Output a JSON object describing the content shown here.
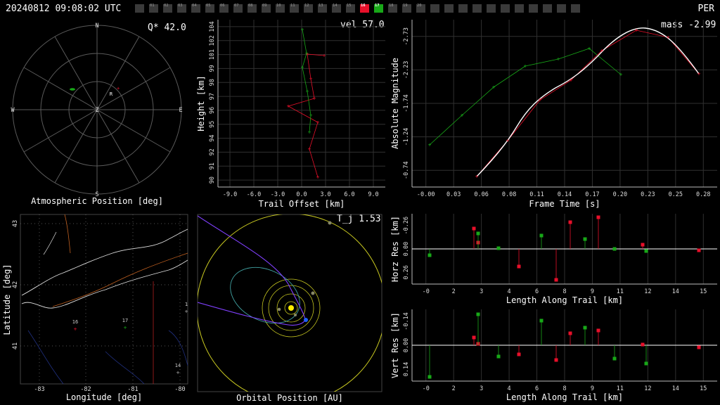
{
  "header": {
    "timestamp": "20240812 09:08:02 UTC",
    "station": "PER",
    "camera_strip": {
      "cells": [
        "",
        "01",
        "02",
        "03",
        "04",
        "05",
        "06",
        "07",
        "08",
        "09",
        "10",
        "11",
        "12",
        "13",
        "14",
        "15",
        "16",
        "17",
        "18",
        "19",
        "20",
        "",
        "",
        "",
        "",
        "",
        "",
        "",
        "",
        "",
        "",
        ""
      ],
      "active_red": "16",
      "active_green": "17",
      "red_color": "#e8102a",
      "green_color": "#18a818"
    }
  },
  "panels": {
    "sky": {
      "title": "Atmospheric Position [deg]",
      "value": "Q* 42.0",
      "compass": {
        "n": "N",
        "s": "S",
        "e": "E",
        "w": "W",
        "z": "Z"
      },
      "marker": "R"
    },
    "height": {
      "title": "Trail Offset [km]",
      "ylabel": "Height [km]",
      "value": "vel 57.0",
      "xticks": [
        "-9.0",
        "-6.0",
        "-3.0",
        "0.0",
        "3.0",
        "6.0",
        "9.0"
      ],
      "yticks": [
        "90",
        "91",
        "92",
        "94",
        "95",
        "96",
        "97",
        "98",
        "99",
        "101",
        "102",
        "104"
      ]
    },
    "mag": {
      "title": "Frame Time [s]",
      "ylabel": "Absolute Magnitude",
      "value": "mass -2.99",
      "xticks": [
        "-0.00",
        "0.03",
        "0.06",
        "0.08",
        "0.11",
        "0.14",
        "0.17",
        "0.20",
        "0.23",
        "0.25",
        "0.28"
      ],
      "yticks": [
        "-0.74",
        "-1.24",
        "-1.74",
        "-2.23",
        "-2.73"
      ]
    },
    "map": {
      "title": "Longitude [deg]",
      "ylabel": "Latitude [deg]",
      "xticks": [
        "-83",
        "-82",
        "-81",
        "-80"
      ],
      "yticks": [
        "41",
        "42",
        "43"
      ],
      "station_labels": [
        "16",
        "17",
        "14",
        "1"
      ]
    },
    "orbit": {
      "title": "Orbital Position [AU]",
      "value": "T_j 1.53"
    },
    "horz": {
      "title": "Length Along Trail [km]",
      "ylabel": "Horz Res [km]",
      "xticks": [
        "-0",
        "2",
        "3",
        "4",
        "6",
        "8",
        "9",
        "11",
        "12",
        "14",
        "15"
      ],
      "yticks": [
        "0.26",
        "0.00",
        "-0.26"
      ]
    },
    "vert": {
      "title": "Length Along Trail [km]",
      "ylabel": "Vert Res [km]",
      "xticks": [
        "-0",
        "2",
        "3",
        "4",
        "6",
        "8",
        "9",
        "11",
        "12",
        "14",
        "15"
      ],
      "yticks": [
        "0.14",
        "0.00",
        "-0.14"
      ]
    }
  },
  "colors": {
    "red": "#e8102a",
    "green": "#18a818",
    "grid": "#303030",
    "axis": "#bbbbbb",
    "orbit_purple": "#8040ff",
    "sun": "#ffee00"
  }
}
